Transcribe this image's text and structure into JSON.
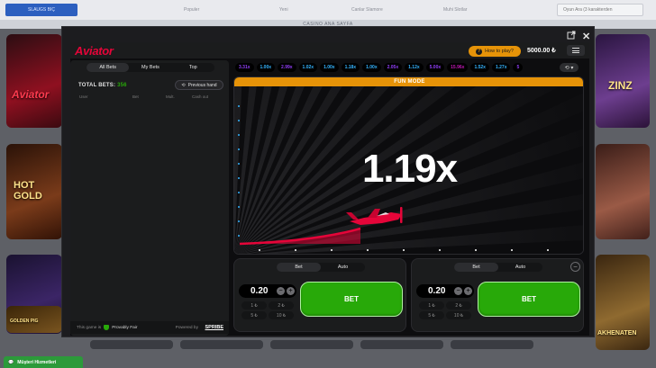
{
  "site": {
    "top_select": "SLAUGS BIÇ",
    "nav": [
      "Populer",
      "Yeni",
      "Canlar Slamore",
      "Muhi Slotlar"
    ],
    "search_placeholder": "Oyun Ara (3 karakterden",
    "sub_title": "CASINO ANA SAYFA",
    "chat_label": "Müşteri Hizmetleri"
  },
  "tiles": [
    {
      "label": "Aviator",
      "accent": "#c11a1a"
    },
    {
      "label": "HOT GOLD",
      "accent": "#8a4d2a"
    },
    {
      "label": "",
      "accent": "#3b2566"
    },
    {
      "label": "GOLDEN PIG",
      "accent": "#5c3b14"
    },
    {
      "label": "ZINZ",
      "accent": "#5e3a7a"
    },
    {
      "label": "",
      "accent": "#7a4a3a"
    },
    {
      "label": "AKHENATEN",
      "accent": "#6b4a1e"
    }
  ],
  "game": {
    "logo": "Aviator",
    "how_to_play": "How to play?",
    "balance": "5000.00 ₺",
    "tabs": [
      "All Bets",
      "My Bets",
      "Top"
    ],
    "total_bets_label": "TOTAL BETS:",
    "total_bets_value": "356",
    "previous_hand": "Previous hand",
    "columns": [
      "User",
      "Bet",
      "Mult.",
      "Cash out"
    ],
    "footer_text": "This game is",
    "provably_fair": "Provably Fair",
    "powered_by": "Powered by",
    "provider": "SPRIBE",
    "history": [
      {
        "value": "3.31x",
        "color": "#913ef8"
      },
      {
        "value": "1.00x",
        "color": "#34b4ff"
      },
      {
        "value": "2.99x",
        "color": "#913ef8"
      },
      {
        "value": "1.02x",
        "color": "#34b4ff"
      },
      {
        "value": "1.00x",
        "color": "#34b4ff"
      },
      {
        "value": "1.18x",
        "color": "#34b4ff"
      },
      {
        "value": "1.00x",
        "color": "#34b4ff"
      },
      {
        "value": "2.05x",
        "color": "#913ef8"
      },
      {
        "value": "1.12x",
        "color": "#34b4ff"
      },
      {
        "value": "5.00x",
        "color": "#913ef8"
      },
      {
        "value": "15.96x",
        "color": "#c017b4"
      },
      {
        "value": "1.52x",
        "color": "#34b4ff"
      },
      {
        "value": "1.27x",
        "color": "#34b4ff"
      },
      {
        "value": "5",
        "color": "#913ef8"
      }
    ],
    "fun_mode": "FUN MODE",
    "multiplier": "1.19x",
    "accent_red": "#e50539",
    "accent_green": "#28a909",
    "accent_orange": "#e69308"
  },
  "bets": [
    {
      "tabs": [
        "Bet",
        "Auto"
      ],
      "stake": "0.20",
      "chips": [
        "1 ₺",
        "2 ₺",
        "5 ₺",
        "10 ₺"
      ],
      "button": "BET"
    },
    {
      "tabs": [
        "Bet",
        "Auto"
      ],
      "stake": "0.20",
      "chips": [
        "1 ₺",
        "2 ₺",
        "5 ₺",
        "10 ₺"
      ],
      "button": "BET"
    }
  ]
}
